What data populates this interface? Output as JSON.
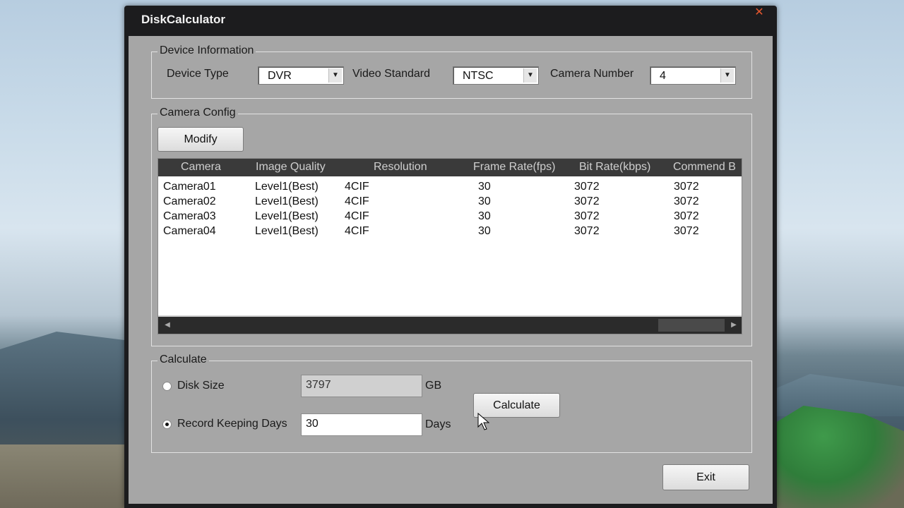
{
  "window": {
    "title": "DiskCalculator",
    "close_glyph": "✕"
  },
  "device_info": {
    "group_title": "Device Information",
    "device_type": {
      "label": "Device Type",
      "value": "DVR"
    },
    "video_standard": {
      "label": "Video Standard",
      "value": "NTSC"
    },
    "camera_number": {
      "label": "Camera Number",
      "value": "4"
    }
  },
  "camera_config": {
    "group_title": "Camera Config",
    "modify_label": "Modify",
    "columns": [
      "Camera",
      "Image Quality",
      "Resolution",
      "Frame Rate(fps)",
      "Bit Rate(kbps)",
      "Commend B"
    ],
    "rows": [
      [
        "Camera01",
        "Level1(Best)",
        "4CIF",
        "30",
        "3072",
        "3072"
      ],
      [
        "Camera02",
        "Level1(Best)",
        "4CIF",
        "30",
        "3072",
        "3072"
      ],
      [
        "Camera03",
        "Level1(Best)",
        "4CIF",
        "30",
        "3072",
        "3072"
      ],
      [
        "Camera04",
        "Level1(Best)",
        "4CIF",
        "30",
        "3072",
        "3072"
      ]
    ]
  },
  "calculate": {
    "group_title": "Calculate",
    "disk_size": {
      "label": "Disk Size",
      "value": "3797",
      "unit": "GB",
      "selected": false
    },
    "record_days": {
      "label": "Record Keeping Days",
      "value": "30",
      "unit": "Days",
      "selected": true
    },
    "calculate_label": "Calculate"
  },
  "exit_label": "Exit"
}
